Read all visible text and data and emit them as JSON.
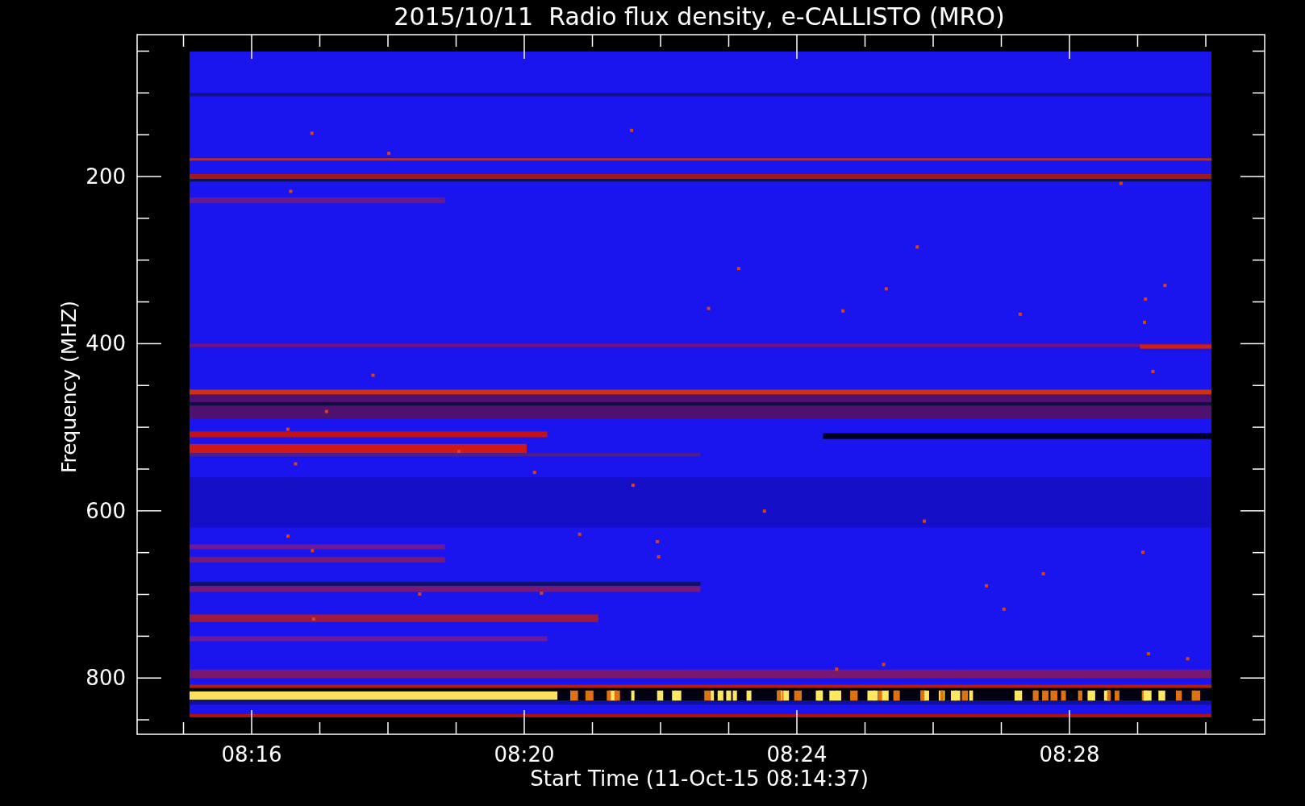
{
  "title": "2015/10/11  Radio flux density, e-CALLISTO (MRO)",
  "ylabel": "Frequency (MHZ)",
  "xlabel": "Start Time (11-Oct-15 08:14:37)",
  "yticks": [
    "200",
    "400",
    "600",
    "800"
  ],
  "xticks": [
    "08:16",
    "08:20",
    "08:24",
    "08:28"
  ]
}
